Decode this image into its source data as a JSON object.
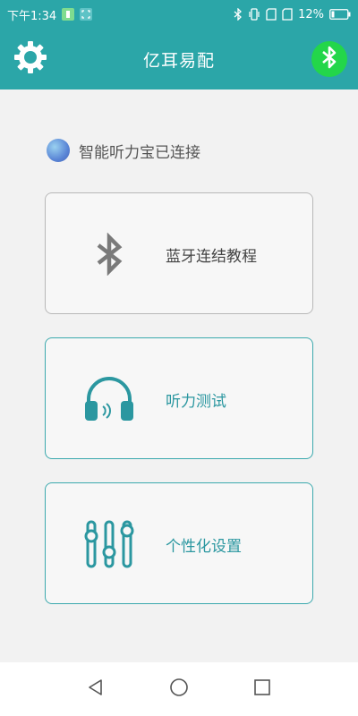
{
  "status_bar": {
    "time": "下午1:34",
    "battery_percent": "12%"
  },
  "header": {
    "title": "亿耳易配"
  },
  "connection": {
    "text": "智能听力宝已连接"
  },
  "cards": [
    {
      "label": "蓝牙连结教程",
      "icon": "bluetooth-icon"
    },
    {
      "label": "听力测试",
      "icon": "headphones-icon"
    },
    {
      "label": "个性化设置",
      "icon": "equalizer-sliders-icon"
    }
  ],
  "colors": {
    "primary": "#2ba6a8",
    "bluetooth_button": "#23d64a",
    "teal_text": "#2b97a0",
    "teal_border": "#3ba9ad",
    "gray_border": "#b8b8b8"
  },
  "nav": {
    "back_icon": "triangle-back-icon",
    "home_icon": "circle-home-icon",
    "recents_icon": "square-recents-icon"
  }
}
